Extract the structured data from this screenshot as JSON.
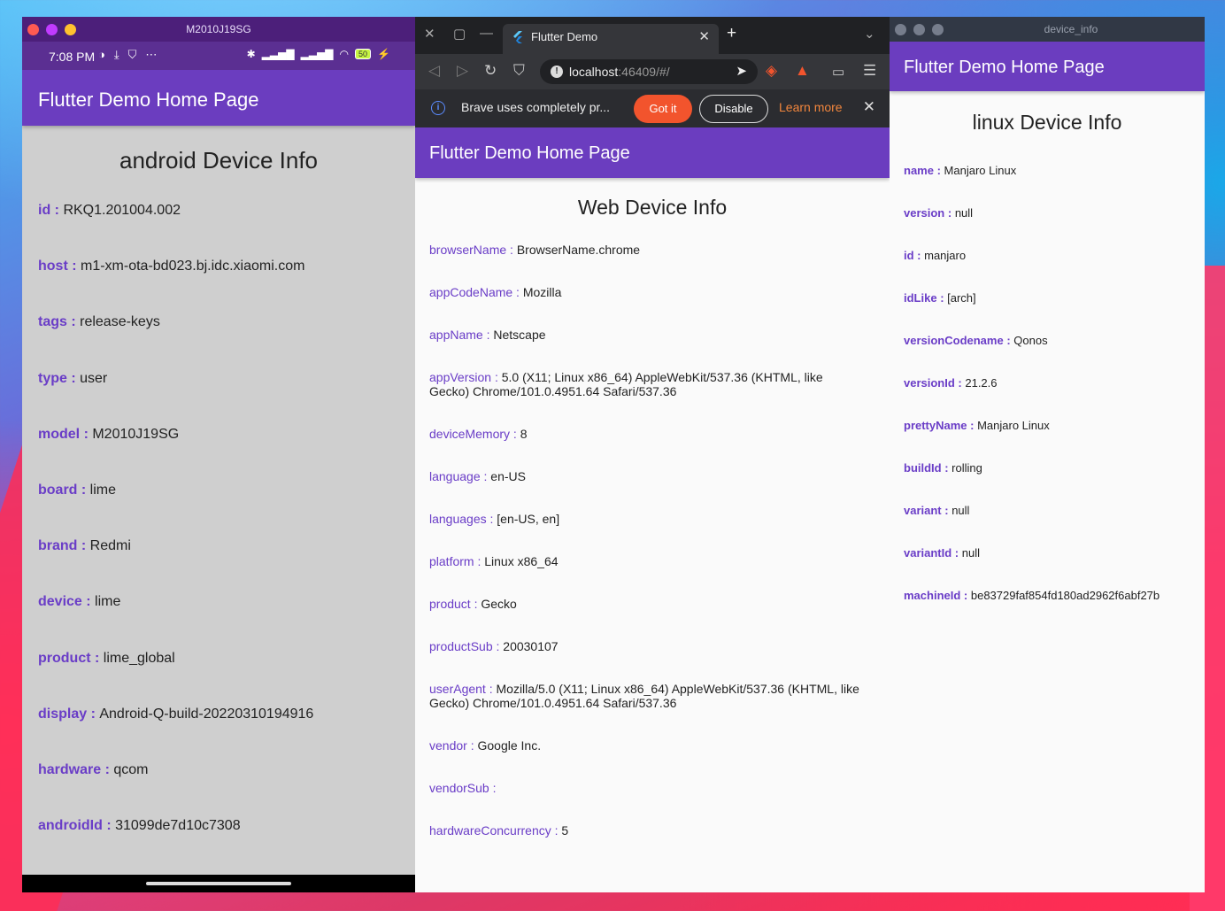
{
  "colors": {
    "accent": "#6b3dbf",
    "label": "#6a3dc7",
    "brave_orange": "#f2542d"
  },
  "android": {
    "window_title": "M2010J19SG",
    "status": {
      "time": "7:08 PM",
      "battery": "50"
    },
    "app_title": "Flutter Demo Home Page",
    "heading": "android Device Info",
    "rows": [
      {
        "k": "id",
        "v": "RKQ1.201004.002"
      },
      {
        "k": "host",
        "v": "m1-xm-ota-bd023.bj.idc.xiaomi.com"
      },
      {
        "k": "tags",
        "v": "release-keys"
      },
      {
        "k": "type",
        "v": "user"
      },
      {
        "k": "model",
        "v": "M2010J19SG"
      },
      {
        "k": "board",
        "v": "lime"
      },
      {
        "k": "brand",
        "v": "Redmi"
      },
      {
        "k": "device",
        "v": "lime"
      },
      {
        "k": "product",
        "v": "lime_global"
      },
      {
        "k": "display",
        "v": "Android-Q-build-20220310194916"
      },
      {
        "k": "hardware",
        "v": "qcom"
      },
      {
        "k": "androidId",
        "v": "31099de7d10c7308"
      }
    ]
  },
  "browser": {
    "tab_title": "Flutter Demo",
    "url_host": "localhost",
    "url_rest": ":46409/#/",
    "notice": {
      "message": "Brave uses completely pr...",
      "got_it": "Got it",
      "disable": "Disable",
      "learn_more": "Learn more"
    },
    "app_title": "Flutter Demo Home Page",
    "heading": "Web Device Info",
    "rows": [
      {
        "k": "browserName",
        "v": "BrowserName.chrome"
      },
      {
        "k": "appCodeName",
        "v": "Mozilla"
      },
      {
        "k": "appName",
        "v": "Netscape"
      },
      {
        "k": "appVersion",
        "v": "5.0 (X11; Linux x86_64) AppleWebKit/537.36 (KHTML, like Gecko) Chrome/101.0.4951.64 Safari/537.36"
      },
      {
        "k": "deviceMemory",
        "v": "8"
      },
      {
        "k": "language",
        "v": "en-US"
      },
      {
        "k": "languages",
        "v": "[en-US, en]"
      },
      {
        "k": "platform",
        "v": "Linux x86_64"
      },
      {
        "k": "product",
        "v": "Gecko"
      },
      {
        "k": "productSub",
        "v": "20030107"
      },
      {
        "k": "userAgent",
        "v": "Mozilla/5.0 (X11; Linux x86_64) AppleWebKit/537.36 (KHTML, like Gecko) Chrome/101.0.4951.64 Safari/537.36"
      },
      {
        "k": "vendor",
        "v": "Google Inc."
      },
      {
        "k": "vendorSub",
        "v": ""
      },
      {
        "k": "hardwareConcurrency",
        "v": "5"
      }
    ]
  },
  "linux": {
    "window_title": "device_info",
    "app_title": "Flutter Demo Home Page",
    "heading": "linux Device Info",
    "rows": [
      {
        "k": "name",
        "v": "Manjaro Linux"
      },
      {
        "k": "version",
        "v": "null"
      },
      {
        "k": "id",
        "v": "manjaro"
      },
      {
        "k": "idLike",
        "v": "[arch]"
      },
      {
        "k": "versionCodename",
        "v": "Qonos"
      },
      {
        "k": "versionId",
        "v": "21.2.6"
      },
      {
        "k": "prettyName",
        "v": "Manjaro Linux"
      },
      {
        "k": "buildId",
        "v": "rolling"
      },
      {
        "k": "variant",
        "v": "null"
      },
      {
        "k": "variantId",
        "v": "null"
      },
      {
        "k": "machineId",
        "v": "be83729faf854fd180ad2962f6abf27b"
      }
    ]
  }
}
